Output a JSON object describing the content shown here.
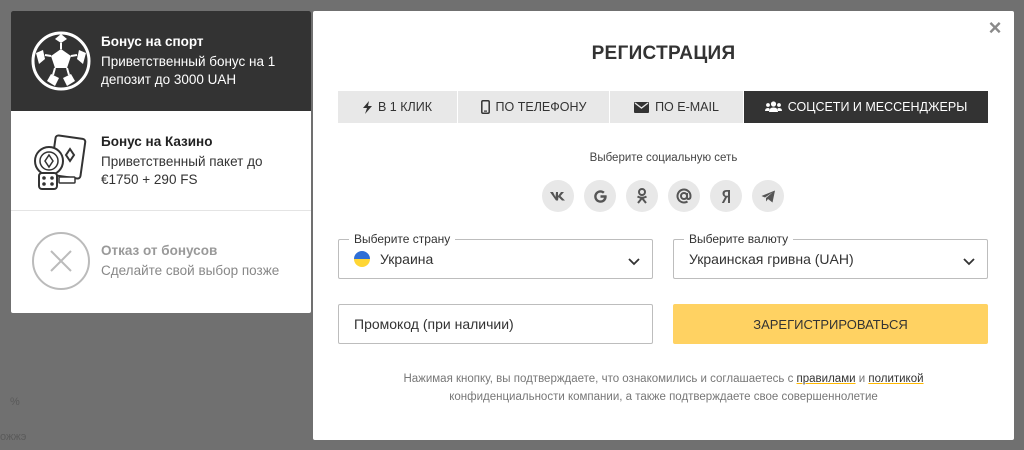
{
  "background": {
    "text_1": "%",
    "text_2": "ожжэ"
  },
  "bonus_panel": {
    "items": [
      {
        "title": "Бонус на спорт",
        "desc": "Приветственный бонус на 1 депозит до 3000 UAH",
        "icon": "soccer-ball-icon",
        "active": true
      },
      {
        "title": "Бонус на Казино",
        "desc": "Приветственный пакет до €1750 + 290 FS",
        "icon": "casino-chips-icon",
        "active": false
      },
      {
        "title": "Отказ от бонусов",
        "desc": "Сделайте свой выбор позже",
        "icon": "cancel-circle-icon",
        "active": false
      }
    ]
  },
  "modal": {
    "title": "РЕГИСТРАЦИЯ",
    "close_label": "×",
    "tabs": [
      {
        "label": "В 1 КЛИК",
        "icon": "lightning-icon"
      },
      {
        "label": "ПО ТЕЛЕФОНУ",
        "icon": "phone-icon"
      },
      {
        "label": "ПО E-MAIL",
        "icon": "envelope-icon"
      },
      {
        "label": "СОЦСЕТИ И МЕССЕНДЖЕРЫ",
        "icon": "users-icon",
        "active": true
      }
    ],
    "social_caption": "Выберите социальную сеть",
    "social": [
      {
        "name": "vk",
        "glyph": "vk"
      },
      {
        "name": "google",
        "glyph": "G"
      },
      {
        "name": "odnoklassniki",
        "glyph": "ok"
      },
      {
        "name": "mail",
        "glyph": "@"
      },
      {
        "name": "yandex",
        "glyph": "Я"
      },
      {
        "name": "telegram",
        "glyph": "tg"
      }
    ],
    "country": {
      "legend": "Выберите страну",
      "value": "Украина"
    },
    "currency": {
      "legend": "Выберите валюту",
      "value": "Украинская гривна (UAH)"
    },
    "promo": {
      "placeholder": "Промокод (при наличии)",
      "value": ""
    },
    "register_label": "ЗАРЕГИСТРИРОВАТЬСЯ",
    "disclaimer": {
      "part1": "Нажимая кнопку, вы подтверждаете, что ознакомились и соглашаетесь с ",
      "rules_link": "правилами",
      "part2": " и ",
      "policy_link": "политикой",
      "part3": "конфиденциальности компании, а также подтверждаете свое совершеннолетие"
    },
    "colors": {
      "accent": "#ffd262",
      "dark": "#333333",
      "tab_bg": "#e8e8e8"
    }
  }
}
